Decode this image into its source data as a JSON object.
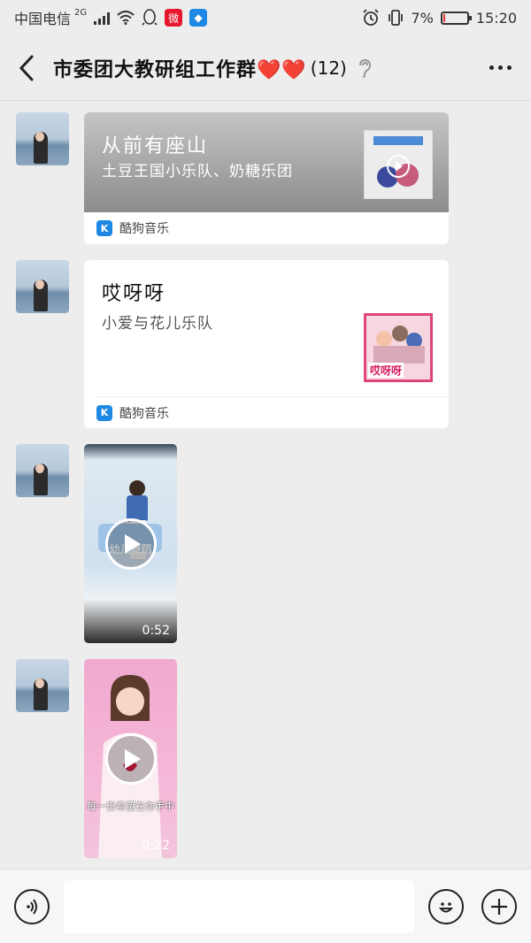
{
  "status_bar": {
    "carrier": "中国电信",
    "network": "2G",
    "battery_percent": "7%",
    "battery_level": 0.07,
    "time": "15:20"
  },
  "header": {
    "title": "市委团大教研组工作群❤️❤️",
    "member_count": "(12)"
  },
  "messages": [
    {
      "type": "music",
      "title": "从前有座山",
      "artist": "土豆王国小乐队、奶糖乐团",
      "source": "酷狗音乐"
    },
    {
      "type": "music",
      "title": "哎呀呀",
      "artist": "小爱与花儿乐队",
      "source": "酷狗音乐",
      "cover_text": "哎呀呀"
    },
    {
      "type": "video",
      "duration": "0:52",
      "overlay_text": "幼儿舞蹈"
    },
    {
      "type": "video",
      "duration": "0:22",
      "caption": "每一份希望在你手中"
    }
  ],
  "input_bar": {
    "value": ""
  },
  "icons": {
    "back": "chevron-left-icon",
    "more": "more-dots-icon",
    "ear": "ear-icon",
    "voice": "voice-icon",
    "emoji": "emoji-icon",
    "add": "plus-icon",
    "kugou": "K"
  },
  "colors": {
    "background": "#ededed",
    "kugou_blue": "#1e88e5",
    "battery_low": "#e53935"
  }
}
